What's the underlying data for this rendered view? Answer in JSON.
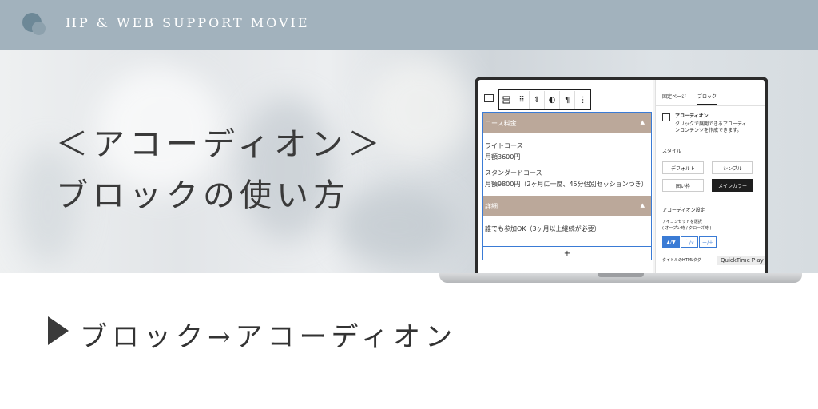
{
  "header": {
    "title": "HP & WEB SUPPORT MOVIE"
  },
  "hero": {
    "title_line1": "＜アコーディオン＞",
    "title_line2": "ブロックの使い方"
  },
  "editor": {
    "toolbar": {
      "icons": [
        "block-type-icon",
        "drag-handle-icon",
        "move-up-down-icon",
        "style-icon",
        "paragraph-icon",
        "more-options-icon"
      ],
      "more_label": "⋮"
    },
    "accordion_items": [
      {
        "heading": "コース料金",
        "arrow": "▲",
        "lines": [
          "ライトコース",
          "月額3600円",
          "スタンダードコース",
          "月額9800円（2ヶ月に一度、45分個別セッションつき）"
        ]
      },
      {
        "heading": "詳細",
        "arrow": "▲",
        "lines": [
          "誰でも参加OK（3ヶ月以上継続が必要）"
        ]
      }
    ],
    "add_button": "+"
  },
  "sidebar": {
    "tabs": [
      "固定ページ",
      "ブロック"
    ],
    "active_tab": "ブロック",
    "block_name": "アコーディオン",
    "block_desc_line1": "クリックで展開できるアコーディ",
    "block_desc_line2": "ンコンテンツを作成できます。",
    "style_label": "スタイル",
    "styles": [
      "デフォルト",
      "シンプル",
      "囲い枠",
      "メインカラー"
    ],
    "selected_style": "メインカラー",
    "settings_label": "アコーディオン設定",
    "icon_set_label": "アイコンセットを選択",
    "icon_set_sub": "( オープン時 / クローズ時 )",
    "icon_sets": [
      "▲/▼",
      "＾/∨",
      "ー/＋"
    ],
    "selected_icon_set": "▲/▼",
    "html_tag_label": "タイトルのHTMLタグ"
  },
  "overlay": {
    "quicktime_label": "QuickTime Play"
  },
  "bottom": {
    "title": "ブロック→アコーディオン"
  },
  "colors": {
    "header_bg": "#a2b2bd",
    "accordion_head": "#bba89a",
    "accent_blue": "#3a7bd5",
    "text_dark": "#333333"
  }
}
